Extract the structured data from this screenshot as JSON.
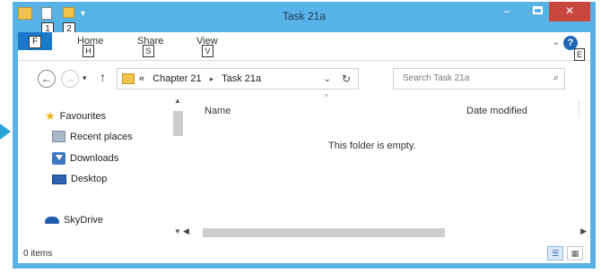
{
  "window": {
    "title": "Task 21a"
  },
  "qat": {
    "key1": "1",
    "key2": "2",
    "dropdown": "▾"
  },
  "window_controls": {
    "minimize": "–",
    "close": "✕"
  },
  "ribbon": {
    "file_label": "F",
    "tabs": [
      {
        "label": "Home",
        "key": "H"
      },
      {
        "label": "Share",
        "key": "S"
      },
      {
        "label": "View",
        "key": "V"
      }
    ],
    "collapse": "⌄",
    "help_key": "E"
  },
  "nav": {
    "back": "←",
    "forward": "→",
    "recent": "▾",
    "up": "↑"
  },
  "address": {
    "prefix": "«",
    "segments": [
      "Chapter 21",
      "Task 21a"
    ],
    "separator": "▸",
    "dropdown": "⌄",
    "refresh": "↻"
  },
  "search": {
    "placeholder": "Search Task 21a"
  },
  "nav_pane": {
    "items": [
      {
        "label": "Favourites",
        "icon": "star-icon"
      },
      {
        "label": "Recent places",
        "icon": "recent-places-icon"
      },
      {
        "label": "Downloads",
        "icon": "downloads-icon"
      },
      {
        "label": "Desktop",
        "icon": "desktop-icon"
      },
      {
        "label": "SkyDrive",
        "icon": "skydrive-cloud-icon"
      }
    ]
  },
  "content": {
    "columns": [
      "Name",
      "Date modified"
    ],
    "sort_indicator": "^",
    "empty_message": "This folder is empty."
  },
  "status": {
    "items_text": "0 items"
  },
  "accent_colors": {
    "titlebar": "#59b2e6",
    "file_tab": "#1979ca",
    "close": "#c7463d",
    "pointer": "#2aa3d8"
  }
}
